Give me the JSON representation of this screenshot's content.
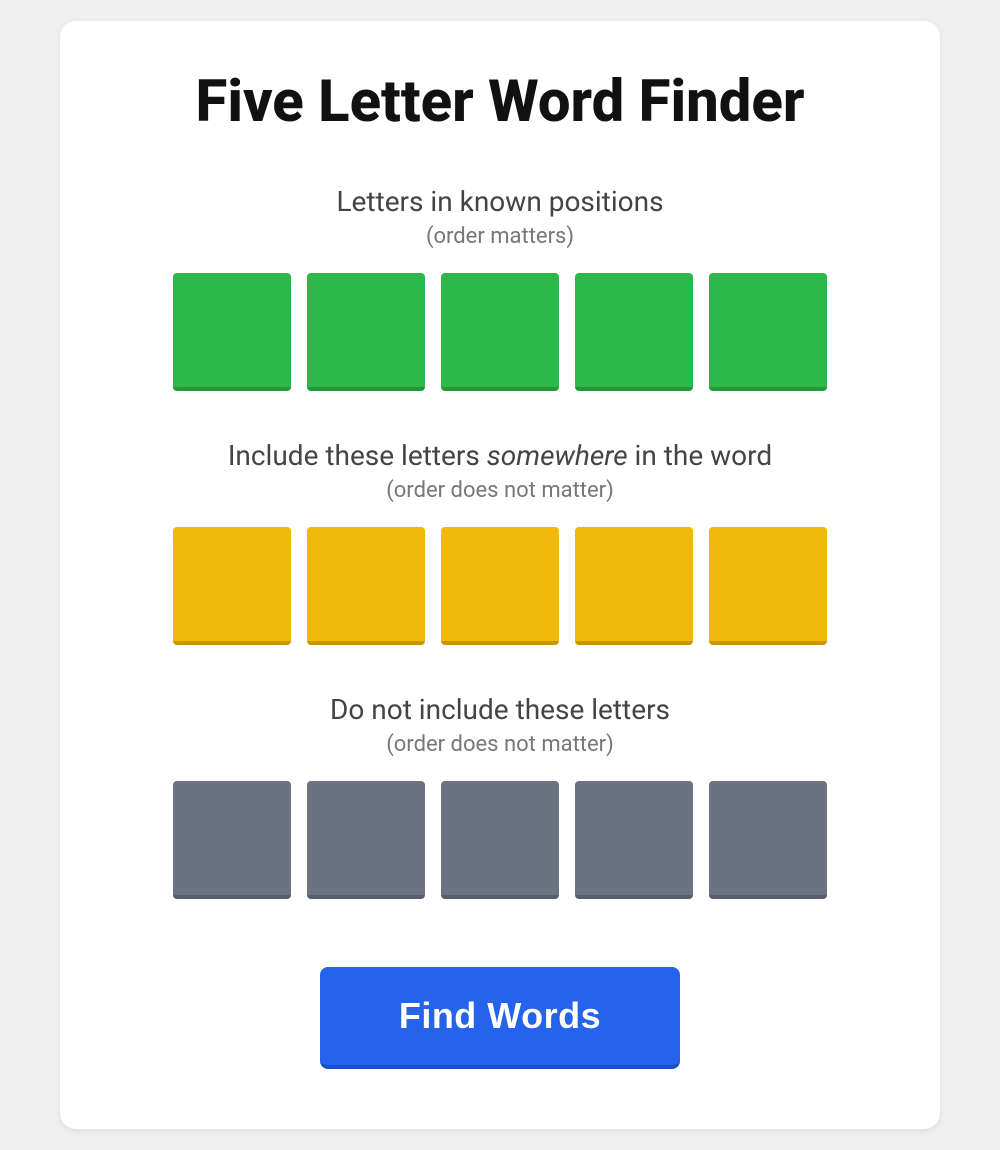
{
  "app": {
    "title": "Five Letter Word Finder"
  },
  "sections": {
    "known_positions": {
      "title": "Letters in known positions",
      "subtitle": "(order matters)",
      "tiles": [
        {
          "value": "",
          "color": "green"
        },
        {
          "value": "",
          "color": "green"
        },
        {
          "value": "",
          "color": "green"
        },
        {
          "value": "",
          "color": "green"
        },
        {
          "value": "",
          "color": "green"
        }
      ]
    },
    "include_letters": {
      "title_plain": "Include these letters ",
      "title_italic": "somewhere",
      "title_end": " in the word",
      "subtitle": "(order does not matter)",
      "tiles": [
        {
          "value": "",
          "color": "yellow"
        },
        {
          "value": "",
          "color": "yellow"
        },
        {
          "value": "",
          "color": "yellow"
        },
        {
          "value": "",
          "color": "yellow"
        },
        {
          "value": "",
          "color": "yellow"
        }
      ]
    },
    "exclude_letters": {
      "title": "Do not include these letters",
      "subtitle": "(order does not matter)",
      "tiles": [
        {
          "value": "",
          "color": "gray"
        },
        {
          "value": "",
          "color": "gray"
        },
        {
          "value": "",
          "color": "gray"
        },
        {
          "value": "",
          "color": "gray"
        },
        {
          "value": "",
          "color": "gray"
        }
      ]
    }
  },
  "button": {
    "label": "Find Words"
  }
}
